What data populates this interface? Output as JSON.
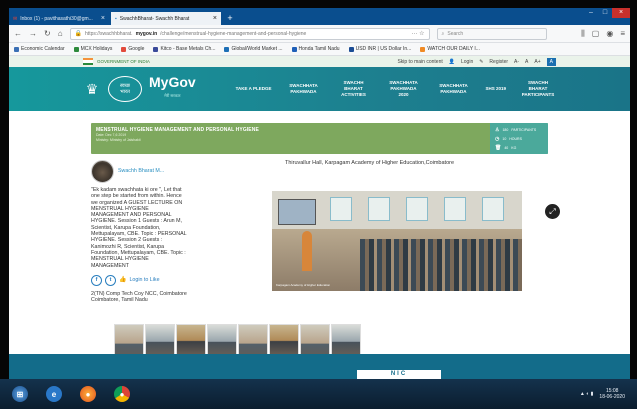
{
  "browser": {
    "tabs": [
      {
        "label": "Inbox (1) - pavithasathi30@gm..."
      },
      {
        "label": "SwachhBharat- Swachh Bharat"
      }
    ],
    "url_prefix": "https://swachhbharat.",
    "url_domain": "mygov.in",
    "url_rest": "/challenge/menstrual-hygiene-management-and-personal-hygiene",
    "search_placeholder": "Search",
    "bookmarks": [
      {
        "label": "Economic Calendar",
        "color": "#3a6fb5"
      },
      {
        "label": "MCX Holidays",
        "color": "#2d8a3b"
      },
      {
        "label": "Google",
        "color": "#e24a3c"
      },
      {
        "label": "Kitco - Base Metals Ch...",
        "color": "#3a4a9a"
      },
      {
        "label": "Global/World Market ...",
        "color": "#1d6fb6"
      },
      {
        "label": "Honda Tamil Nadu",
        "color": "#1f5fb8"
      },
      {
        "label": "USD INR | US Dollar In...",
        "color": "#1b4c95"
      },
      {
        "label": "WATCH OUR DAILY I...",
        "color": "#f08a24"
      }
    ]
  },
  "govbar": {
    "label": "GOVERNMENT OF INDIA",
    "skip": "Skip to main content",
    "login": "Login",
    "register": "Register",
    "a_small": "A-",
    "a_normal": "A",
    "a_large": "A+",
    "a_contrast": "A"
  },
  "header": {
    "logo_text_top": "स्वच्छ",
    "logo_text_bottom": "भारत",
    "mygov_label": "MyGov",
    "mygov_sub": "मेरी सरकार",
    "menu": [
      "TAKE A PLEDGE",
      "SWACHHATA PAKHWADA",
      "SWACHH BHARAT ACTIVITIES",
      "SWACHHATA PAKHWADA 2020",
      "SWACHHATA PAKHWADA",
      "SHS 2019",
      "SWACHH BHARAT PARTICIPANTS"
    ]
  },
  "banner": {
    "title": "MENSTRUAL HYGIENE MANAGEMENT AND PERSONAL HYGIENE",
    "date": "Date: Dec 7,6 2019",
    "ministry": "Ministry: Ministry of Jalshakti",
    "participants": "PARTICIPANTS",
    "hours": "HOURS",
    "kg": "KG",
    "participants_value": "180",
    "hours_value": "10",
    "kg_value": "40"
  },
  "post": {
    "username": "Swachh Bharat M...",
    "description": "\"Ek kadam swachhata ki ore \", Let that one step be started from within. Hence we organized A GUEST LECTURE ON MENSTRUAL HYGIENE MANAGEMENT AND PERSONAL HYGIENE. Session 1 Guests : Arun M, Scientist, Karupa Foundation, Mettupalayam, CBE. Topic : PERSONAL HYGIENE. Session 2 Guests : Kanimozhi R, Scientist, Karupa Foundation, Mettupalayam, CBE. Topic : MENSTRUAL HYGIENE MANAGEMENT",
    "facebook": "f",
    "twitter": "t",
    "login_like": "Login to Like",
    "org": "2(TN) Comp Tech Coy NCC, Coimbatore",
    "location": "Coimbatore, Tamil Nadu",
    "venue": "Thiruvallur Hall, Karpagam Academy of Higher Education,Coimbatore",
    "photo_caption": "Karpagam Academy of Higher Education"
  },
  "footer": {
    "nic_label": "NIC"
  },
  "taskbar": {
    "time": "15:08",
    "date": "18-06-2020"
  }
}
